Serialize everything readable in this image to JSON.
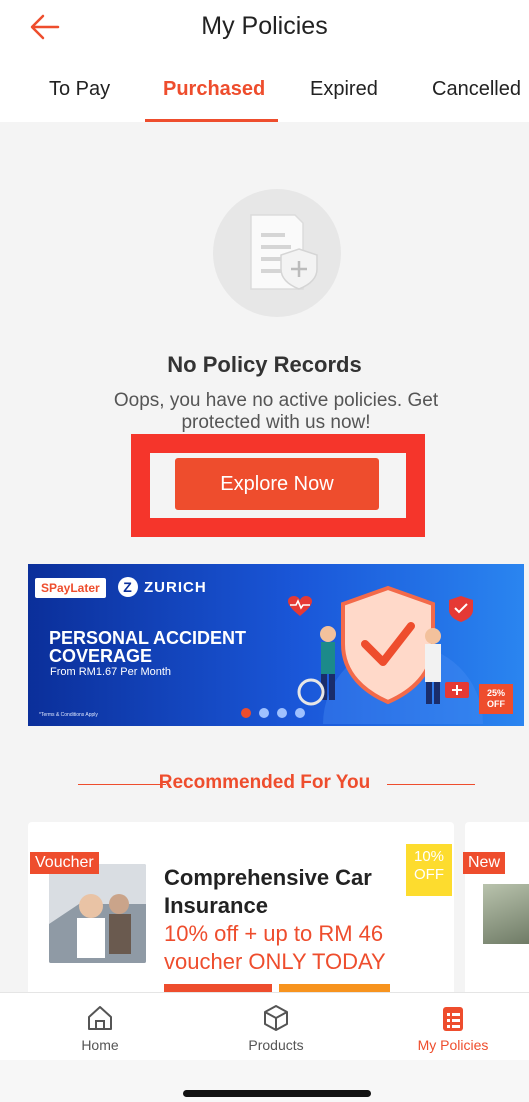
{
  "header": {
    "title": "My Policies"
  },
  "tabs": [
    {
      "label": "To Pay"
    },
    {
      "label": "Purchased"
    },
    {
      "label": "Expired"
    },
    {
      "label": "Cancelled"
    }
  ],
  "empty_state": {
    "title": "No Policy Records",
    "description": "Oops, you have no active policies. Get protected with us now!",
    "button_label": "Explore Now"
  },
  "banner": {
    "brand1": "SPayLater",
    "brand2": "ZURICH",
    "headline": "PERSONAL ACCIDENT COVERAGE",
    "subline": "From RM1.67 Per Month",
    "terms": "*Terms & Conditions Apply",
    "badge": "25% OFF"
  },
  "recommended": {
    "title": "Recommended For You",
    "cards": [
      {
        "tag": "Voucher",
        "ribbon": "10% OFF",
        "title": "Comprehensive Car Insurance",
        "promo": "10% off + up to RM 46 voucher ONLY TODAY"
      },
      {
        "tag": "New"
      }
    ]
  },
  "bottom_nav": [
    {
      "label": "Home"
    },
    {
      "label": "Products"
    },
    {
      "label": "My Policies"
    }
  ],
  "colors": {
    "accent": "#ee4d2d",
    "highlight": "#f5352b",
    "ribbon": "#fddc2e"
  }
}
